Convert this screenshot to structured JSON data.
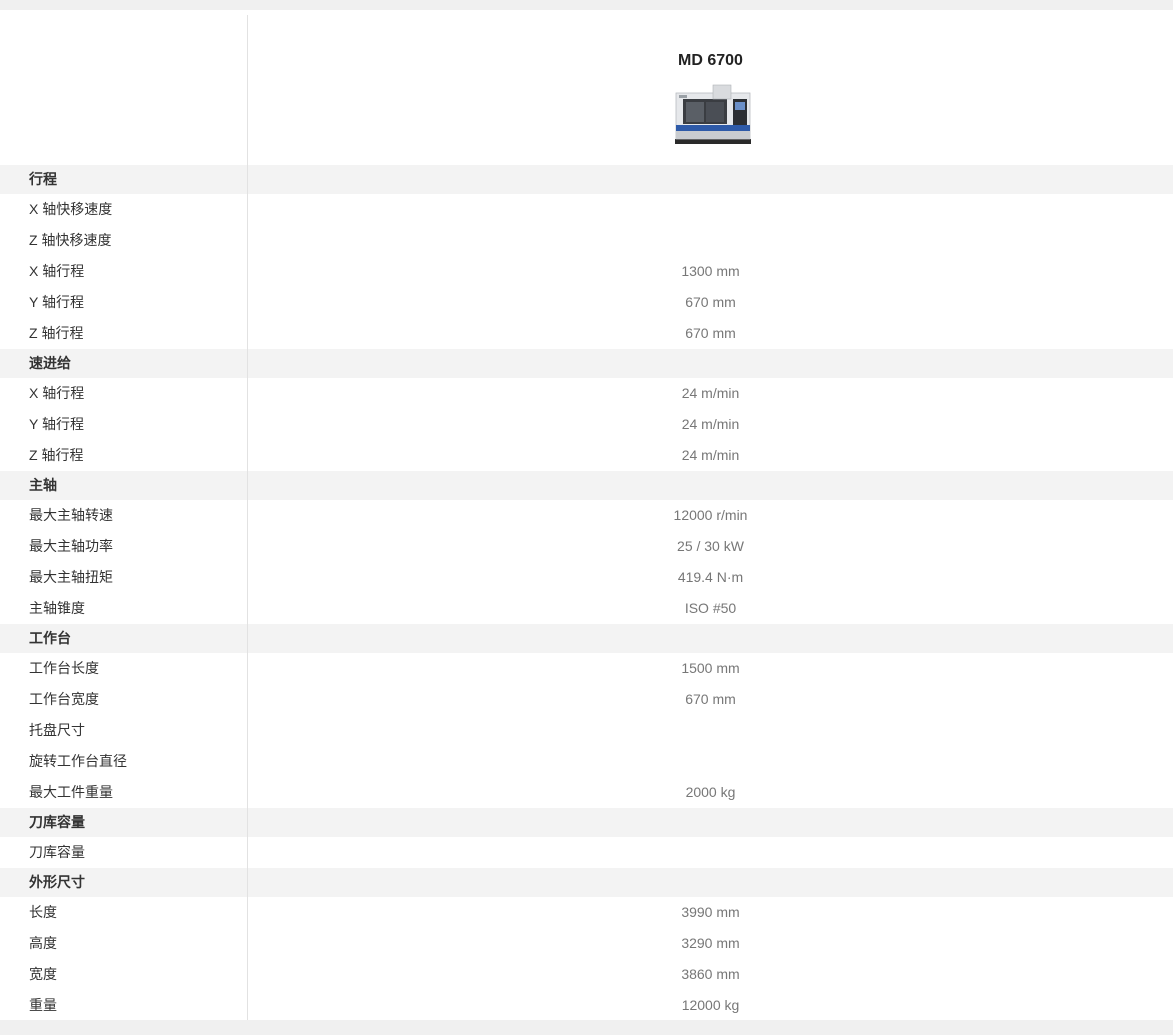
{
  "model": {
    "name": "MD 6700",
    "image_label": "machine-photo"
  },
  "sections": [
    {
      "title": "行程",
      "rows": [
        {
          "label": "X 轴快移速度",
          "value": ""
        },
        {
          "label": "Z 轴快移速度",
          "value": ""
        },
        {
          "label": "X 轴行程",
          "value": "1300 mm"
        },
        {
          "label": "Y 轴行程",
          "value": "670 mm"
        },
        {
          "label": "Z 轴行程",
          "value": "670 mm"
        }
      ]
    },
    {
      "title": "速进给",
      "rows": [
        {
          "label": "X 轴行程",
          "value": "24 m/min"
        },
        {
          "label": "Y 轴行程",
          "value": "24 m/min"
        },
        {
          "label": "Z 轴行程",
          "value": "24 m/min"
        }
      ]
    },
    {
      "title": "主轴",
      "rows": [
        {
          "label": "最大主轴转速",
          "value": "12000 r/min"
        },
        {
          "label": "最大主轴功率",
          "value": "25 / 30 kW"
        },
        {
          "label": "最大主轴扭矩",
          "value": "419.4 N·m"
        },
        {
          "label": "主轴锥度",
          "value": "ISO #50"
        }
      ]
    },
    {
      "title": "工作台",
      "rows": [
        {
          "label": "工作台长度",
          "value": "1500 mm"
        },
        {
          "label": "工作台宽度",
          "value": "670 mm"
        },
        {
          "label": "托盘尺寸",
          "value": ""
        },
        {
          "label": "旋转工作台直径",
          "value": ""
        },
        {
          "label": "最大工件重量",
          "value": "2000 kg"
        }
      ]
    },
    {
      "title": "刀库容量",
      "rows": [
        {
          "label": "刀库容量",
          "value": ""
        }
      ]
    },
    {
      "title": "外形尺寸",
      "rows": [
        {
          "label": "长度",
          "value": "3990 mm"
        },
        {
          "label": "高度",
          "value": "3290 mm"
        },
        {
          "label": "宽度",
          "value": "3860 mm"
        },
        {
          "label": "重量",
          "value": "12000 kg"
        }
      ]
    }
  ]
}
